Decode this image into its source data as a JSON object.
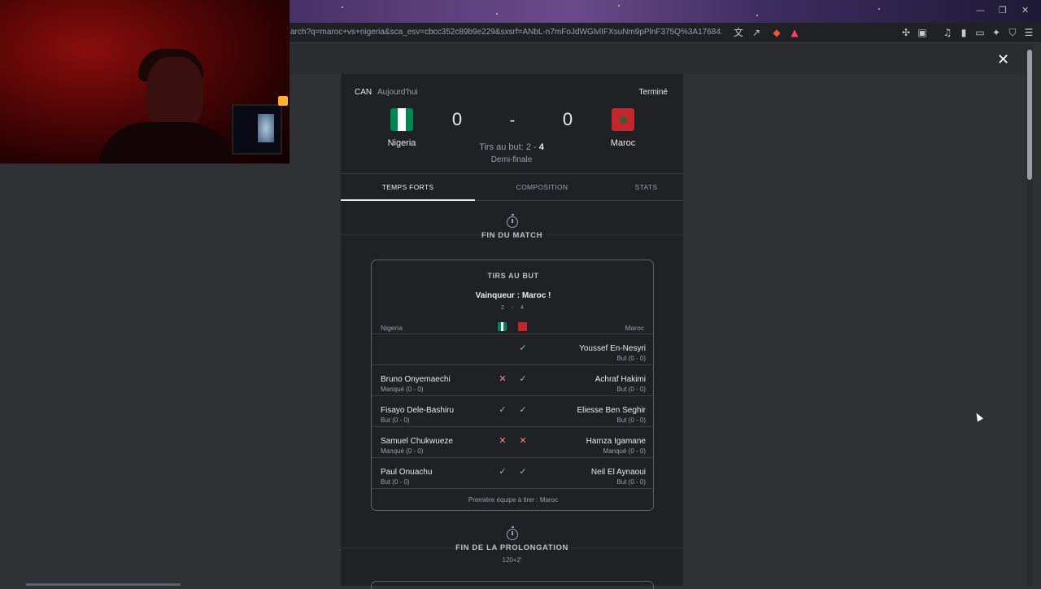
{
  "browser": {
    "url": "arch?q=maroc+vs+nigeria&sca_esv=cbcc352c89b9e229&sxsrf=ANbL-n7mFoJdWGlvlIFXsuNm9pPlnF375Q%3A1768429396391..."
  },
  "match": {
    "league": "CAN",
    "date": "Aujourd'hui",
    "status": "Terminé",
    "home": {
      "name": "Nigeria",
      "score": "0",
      "colors": [
        "#008751",
        "#ffffff",
        "#008751"
      ]
    },
    "away": {
      "name": "Maroc",
      "score": "0",
      "color": "#c1272d"
    },
    "separator": "-",
    "penalties_label": "Tirs au but: 2 - ",
    "penalties_away": "4",
    "round": "Demi-finale"
  },
  "tabs": [
    {
      "label": "TEMPS FORTS",
      "active": true
    },
    {
      "label": "COMPOSITION",
      "active": false
    },
    {
      "label": "STATS",
      "active": false
    }
  ],
  "events": {
    "end_match": "FIN DU MATCH",
    "end_extra": "FIN DE LA PROLONGATION",
    "end_extra_time": "120+2'"
  },
  "shootout": {
    "title": "TIRS AU BUT",
    "winner": "Vainqueur : Maroc !",
    "home_score": "2",
    "away_score": "4",
    "dash": "-",
    "home_label": "Nigeria",
    "away_label": "Maroc",
    "rows": [
      {
        "home_name": "",
        "home_res": "",
        "home_mark": "",
        "away_mark": "ok",
        "away_name": "Youssef En-Nesyri",
        "away_res": "But (0 - 0)"
      },
      {
        "home_name": "Bruno Onyemaechi",
        "home_res": "Manqué (0 - 0)",
        "home_mark": "ko",
        "away_mark": "ok",
        "away_name": "Achraf Hakimi",
        "away_res": "But (0 - 0)"
      },
      {
        "home_name": "Fisayo Dele-Bashiru",
        "home_res": "But (0 - 0)",
        "home_mark": "ok",
        "away_mark": "ok",
        "away_name": "Eliesse Ben Seghir",
        "away_res": "But (0 - 0)"
      },
      {
        "home_name": "Samuel Chukwueze",
        "home_res": "Manqué (0 - 0)",
        "home_mark": "ko",
        "away_mark": "ko",
        "away_name": "Hamza Igamane",
        "away_res": "Manqué (0 - 0)"
      },
      {
        "home_name": "Paul Onuachu",
        "home_res": "But (0 - 0)",
        "home_mark": "ok",
        "away_mark": "ok",
        "away_name": "Neil El Aynaoui",
        "away_res": "But (0 - 0)"
      }
    ],
    "footer": "Première équipe à tirer : Maroc"
  },
  "icons": {
    "close": "✕",
    "ok": "✓",
    "ko": "✕"
  }
}
